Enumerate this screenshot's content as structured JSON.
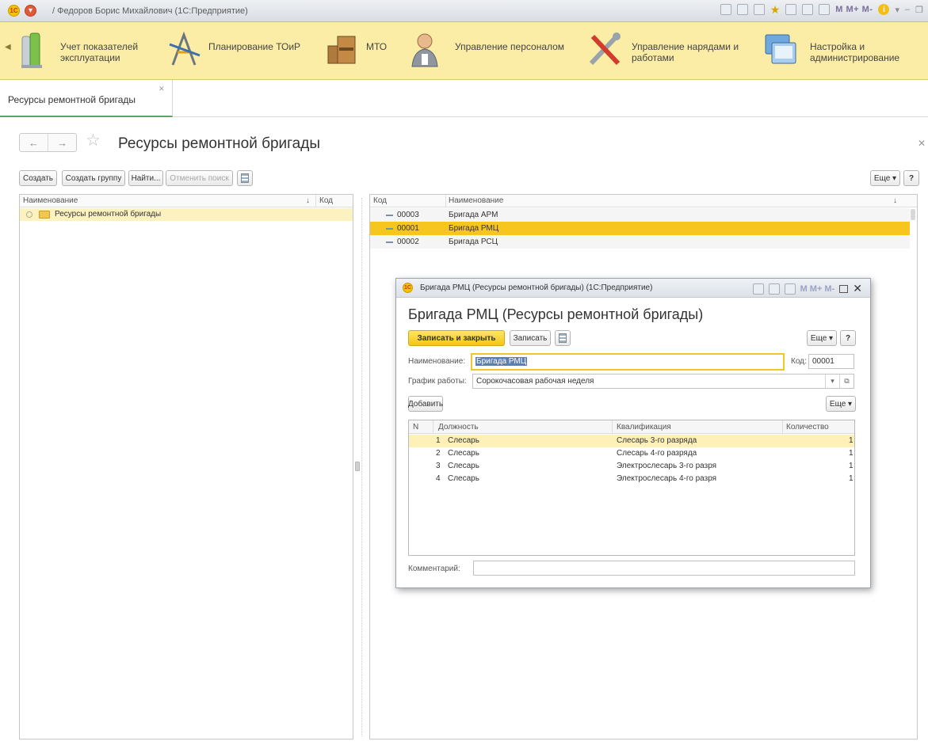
{
  "window": {
    "title": "/ Федоров Борис Михайлович  (1С:Предприятие)",
    "logo_text": "1С",
    "toolbar_m_labels": "M  M+  M-"
  },
  "sections": [
    {
      "label": "Учет показателей эксплуатации",
      "icon": "bottles-icon"
    },
    {
      "label": "Планирование ТОиР",
      "icon": "drafting-tools-icon"
    },
    {
      "label": "МТО",
      "icon": "boxes-icon"
    },
    {
      "label": "Управление персоналом",
      "icon": "person-icon"
    },
    {
      "label": "Управление нарядами и работами",
      "icon": "wrench-screwdriver-icon"
    },
    {
      "label": "Настройка и администрирование",
      "icon": "computer-icon"
    }
  ],
  "tabs": [
    {
      "label": "Ресурсы ремонтной бригады"
    }
  ],
  "form": {
    "title": "Ресурсы ремонтной бригады",
    "toolbar": {
      "create": "Создать",
      "create_group": "Создать группу",
      "find": "Найти...",
      "cancel_search": "Отменить поиск",
      "more": "Еще",
      "help": "?"
    },
    "tree": {
      "columns": {
        "name": "Наименование",
        "code": "Код"
      },
      "rows": [
        {
          "name": "Ресурсы ремонтной бригады"
        }
      ]
    },
    "list": {
      "columns": {
        "code": "Код",
        "name": "Наименование"
      },
      "rows": [
        {
          "code": "00003",
          "name": "Бригада АРМ"
        },
        {
          "code": "00001",
          "name": "Бригада РМЦ"
        },
        {
          "code": "00002",
          "name": "Бригада РСЦ"
        }
      ],
      "selected_index": 1
    }
  },
  "modal": {
    "window_title": "Бригада РМЦ (Ресурсы ремонтной бригады)  (1С:Предприятие)",
    "heading": "Бригада РМЦ (Ресурсы ремонтной бригады)",
    "toolbar": {
      "save_close": "Записать и закрыть",
      "save": "Записать",
      "more": "Еще",
      "help": "?"
    },
    "name_label": "Наименование:",
    "name_value": "Бригада РМЦ",
    "code_label": "Код:",
    "code_value": "00001",
    "schedule_label": "График работы:",
    "schedule_value": "Сорокочасовая рабочая неделя",
    "add_button": "Добавить",
    "table_more": "Еще",
    "table": {
      "columns": {
        "n": "N",
        "position": "Должность",
        "qualification": "Квалификация",
        "quantity": "Количество"
      },
      "rows": [
        {
          "n": "1",
          "position": "Слесарь",
          "qualification": "Слесарь 3-го разряда",
          "quantity": "1"
        },
        {
          "n": "2",
          "position": "Слесарь",
          "qualification": "Слесарь 4-го разряда",
          "quantity": "1"
        },
        {
          "n": "3",
          "position": "Слесарь",
          "qualification": "Электрослесарь 3-го разря",
          "quantity": "1"
        },
        {
          "n": "4",
          "position": "Слесарь",
          "qualification": "Электрослесарь 4-го разря",
          "quantity": "1"
        }
      ]
    },
    "comment_label": "Комментарий:",
    "comment_value": ""
  },
  "colors": {
    "sections_bg": "#fbeca6",
    "selection": "#f6c61e",
    "accent_yellow": "#f4c714",
    "tab_underline": "#5aa469"
  }
}
